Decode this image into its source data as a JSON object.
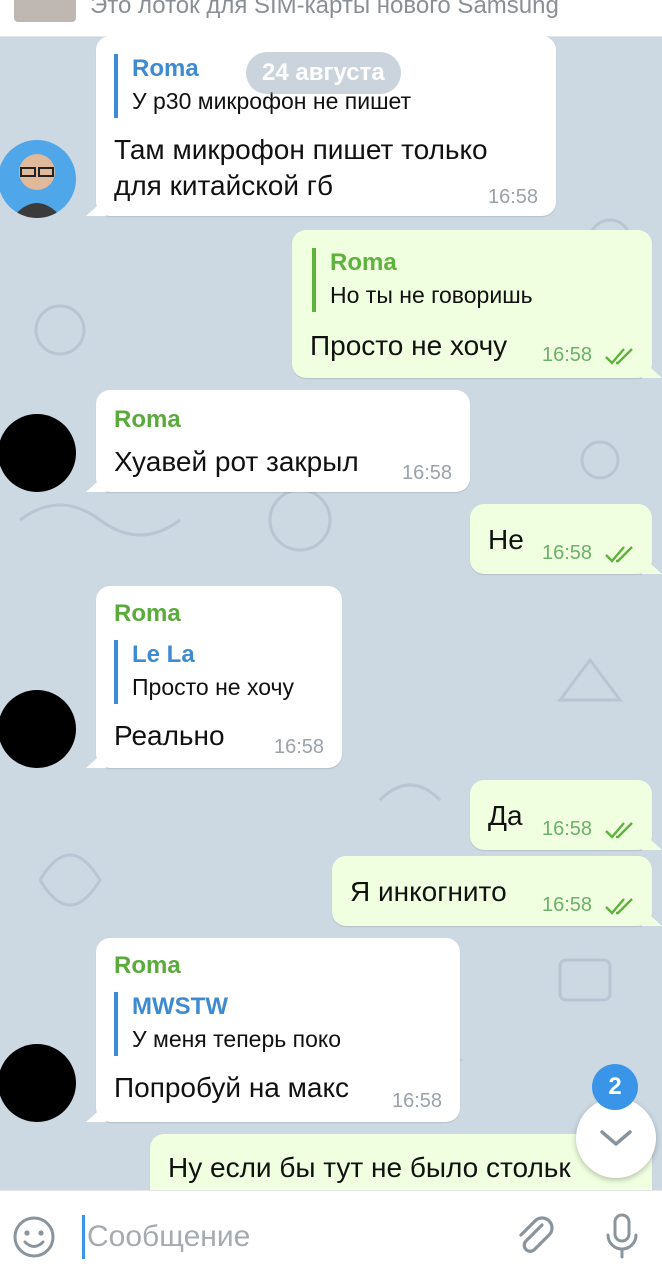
{
  "pinned": {
    "text": "Это лоток для SIM-карты нового Samsung"
  },
  "date_label": "24 августа",
  "messages": [
    {
      "sender": "",
      "reply_name": "Roma",
      "reply_text": "У p30 микрофон не пишет",
      "text_lines": [
        "Там микрофон пишет только",
        "для китайской гб"
      ],
      "time": "16:58"
    },
    {
      "reply_name": "Roma",
      "reply_text": "Но ты не говоришь",
      "text": "Просто не хочу",
      "time": "16:58"
    },
    {
      "sender": "Roma",
      "text": "Хуавей рот закрыл",
      "time": "16:58"
    },
    {
      "text": "Не",
      "time": "16:58"
    },
    {
      "sender": "Roma",
      "reply_name": "Le La",
      "reply_text": "Просто не хочу",
      "text": "Реально",
      "time": "16:58"
    },
    {
      "text": "Да",
      "time": "16:58"
    },
    {
      "text": "Я инкогнито",
      "time": "16:58"
    },
    {
      "sender": "Roma",
      "reply_name": "MWSTW",
      "reply_text": "У меня теперь поко",
      "text": "Попробуй на макс",
      "time": "16:58"
    },
    {
      "text": "Ну если бы тут не было стольк"
    }
  ],
  "unread_count": "2",
  "input": {
    "placeholder": "Сообщение"
  },
  "icons": {
    "emoji": "emoji-icon",
    "attach": "paperclip-icon",
    "mic": "microphone-icon",
    "scroll": "chevron-down-icon",
    "read": "double-check-icon"
  },
  "colors": {
    "background": "#ccd8e2",
    "incoming": "#ffffff",
    "outgoing": "#efffdf",
    "accent": "#3a95e8",
    "sender": "#5aaa3c"
  }
}
